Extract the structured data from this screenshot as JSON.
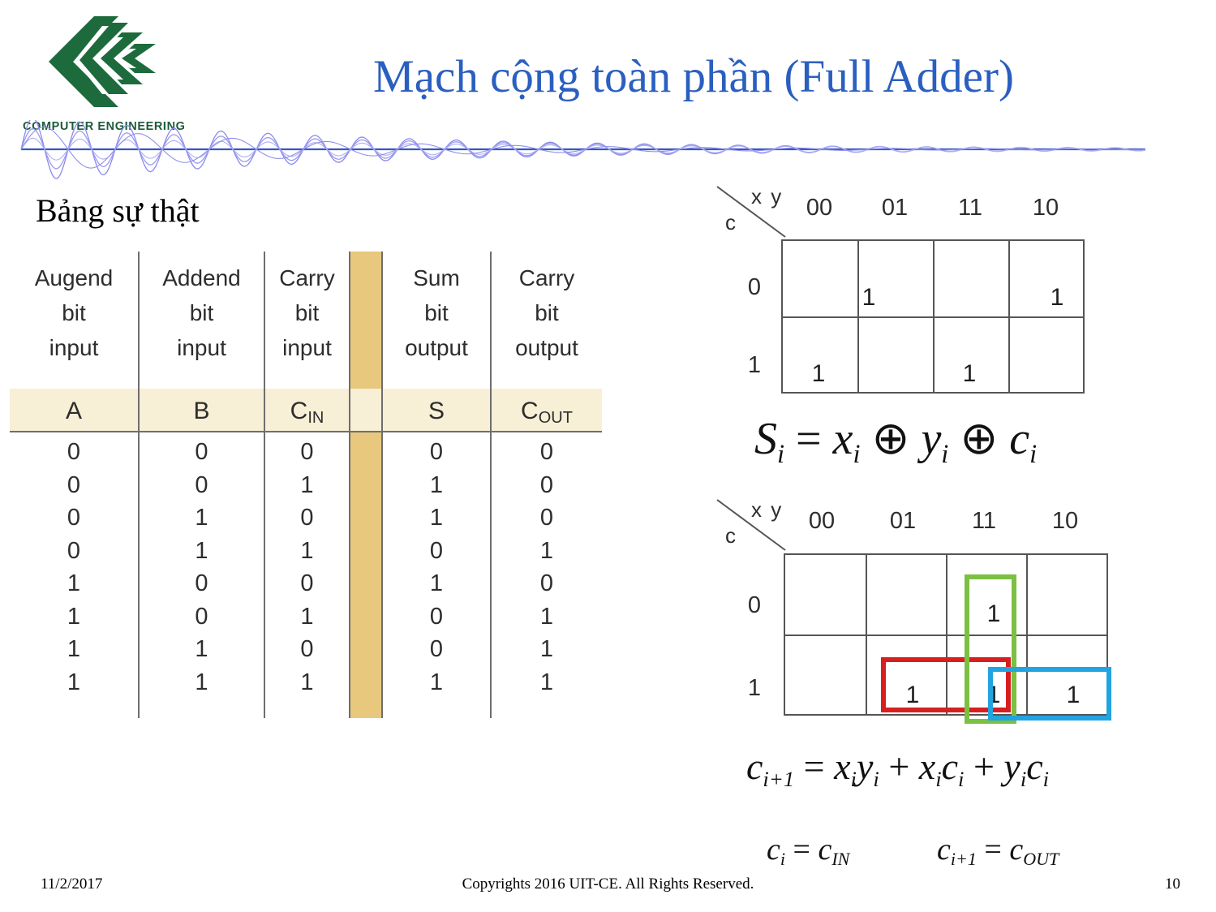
{
  "slide": {
    "title": "Mạch cộng toàn phần (Full Adder)",
    "title_color": "#2a5fc0",
    "logo_caption": "COMPUTER ENGINEERING",
    "logo_green": "#1d6b3d",
    "logo_gold": "#e7bd63"
  },
  "left": {
    "heading": "Bảng sự thật"
  },
  "truth_table": {
    "highlight_color": "#e8c87c",
    "header_band_color": "#f7efd6",
    "columns": [
      {
        "head_line1": "Augend",
        "head_line2": "bit",
        "head_line3": "input",
        "symbol": "A",
        "symbol_sub": ""
      },
      {
        "head_line1": "Addend",
        "head_line2": "bit",
        "head_line3": "input",
        "symbol": "B",
        "symbol_sub": ""
      },
      {
        "head_line1": "Carry",
        "head_line2": "bit",
        "head_line3": "input",
        "symbol": "C",
        "symbol_sub": "IN"
      },
      {
        "head_line1": "Sum",
        "head_line2": "bit",
        "head_line3": "output",
        "symbol": "S",
        "symbol_sub": ""
      },
      {
        "head_line1": "Carry",
        "head_line2": "bit",
        "head_line3": "output",
        "symbol": "C",
        "symbol_sub": "OUT"
      }
    ],
    "rows": [
      [
        "0",
        "0",
        "0",
        "0",
        "0"
      ],
      [
        "0",
        "0",
        "1",
        "1",
        "0"
      ],
      [
        "0",
        "1",
        "0",
        "1",
        "0"
      ],
      [
        "0",
        "1",
        "1",
        "0",
        "1"
      ],
      [
        "1",
        "0",
        "0",
        "1",
        "0"
      ],
      [
        "1",
        "0",
        "1",
        "0",
        "1"
      ],
      [
        "1",
        "1",
        "0",
        "0",
        "1"
      ],
      [
        "1",
        "1",
        "1",
        "1",
        "1"
      ]
    ]
  },
  "kmap_sum": {
    "corner_top_label": "x y",
    "corner_bottom_label": "c",
    "col_headers": [
      "00",
      "01",
      "11",
      "10"
    ],
    "row_headers": [
      "0",
      "1"
    ],
    "cells": [
      [
        "",
        "1",
        "",
        "1"
      ],
      [
        "1",
        "",
        "1",
        ""
      ]
    ]
  },
  "kmap_carry": {
    "corner_top_label": "x y",
    "corner_bottom_label": "c",
    "col_headers": [
      "00",
      "01",
      "11",
      "10"
    ],
    "row_headers": [
      "0",
      "1"
    ],
    "cells": [
      [
        "",
        "",
        "1",
        ""
      ],
      [
        "",
        "1",
        "1",
        "1"
      ]
    ],
    "groups": [
      {
        "name": "green-group",
        "color": "#7bc043"
      },
      {
        "name": "red-group",
        "color": "#d81f20"
      },
      {
        "name": "blue-group",
        "color": "#22a4e0"
      }
    ]
  },
  "equations": {
    "sum_lhs": "S",
    "sum_lhs_sub": "i",
    "sum_rhs": "= x",
    "sum_text": "Si = xi ⊕ yi ⊕ ci",
    "carry_text": "ci+1 = xi yi + xi ci + yi ci",
    "ci_text": "ci = cIN",
    "cout_text": "ci+1 = cOUT"
  },
  "footer": {
    "date": "11/2/2017",
    "copyright": "Copyrights 2016 UIT-CE. All Rights Reserved.",
    "page": "10"
  }
}
